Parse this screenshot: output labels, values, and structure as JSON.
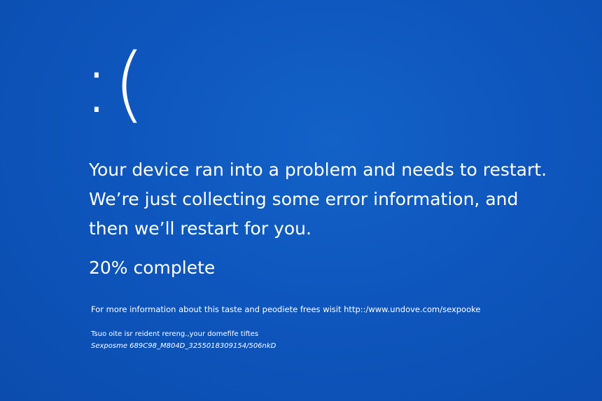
{
  "screen": {
    "background_color": "#0e56bd",
    "text_color": "#ffffff",
    "face": ":(",
    "message_lines": [
      "Your device ran into a problem and needs to restart.",
      "We’re just collecting some error information, and",
      "then we’ll restart for you."
    ],
    "progress": {
      "text": "20% complete",
      "percent": 20
    },
    "info_text": "For more information about this taste and peodiete frees wisit http::/www.undove.com/sexpooke",
    "support_line": "Tsuo oite isr reident rereng.,your domefife tiftes",
    "stop_code_line": "Sexposme 689C98_M804D_3255018309154/506nkD"
  }
}
